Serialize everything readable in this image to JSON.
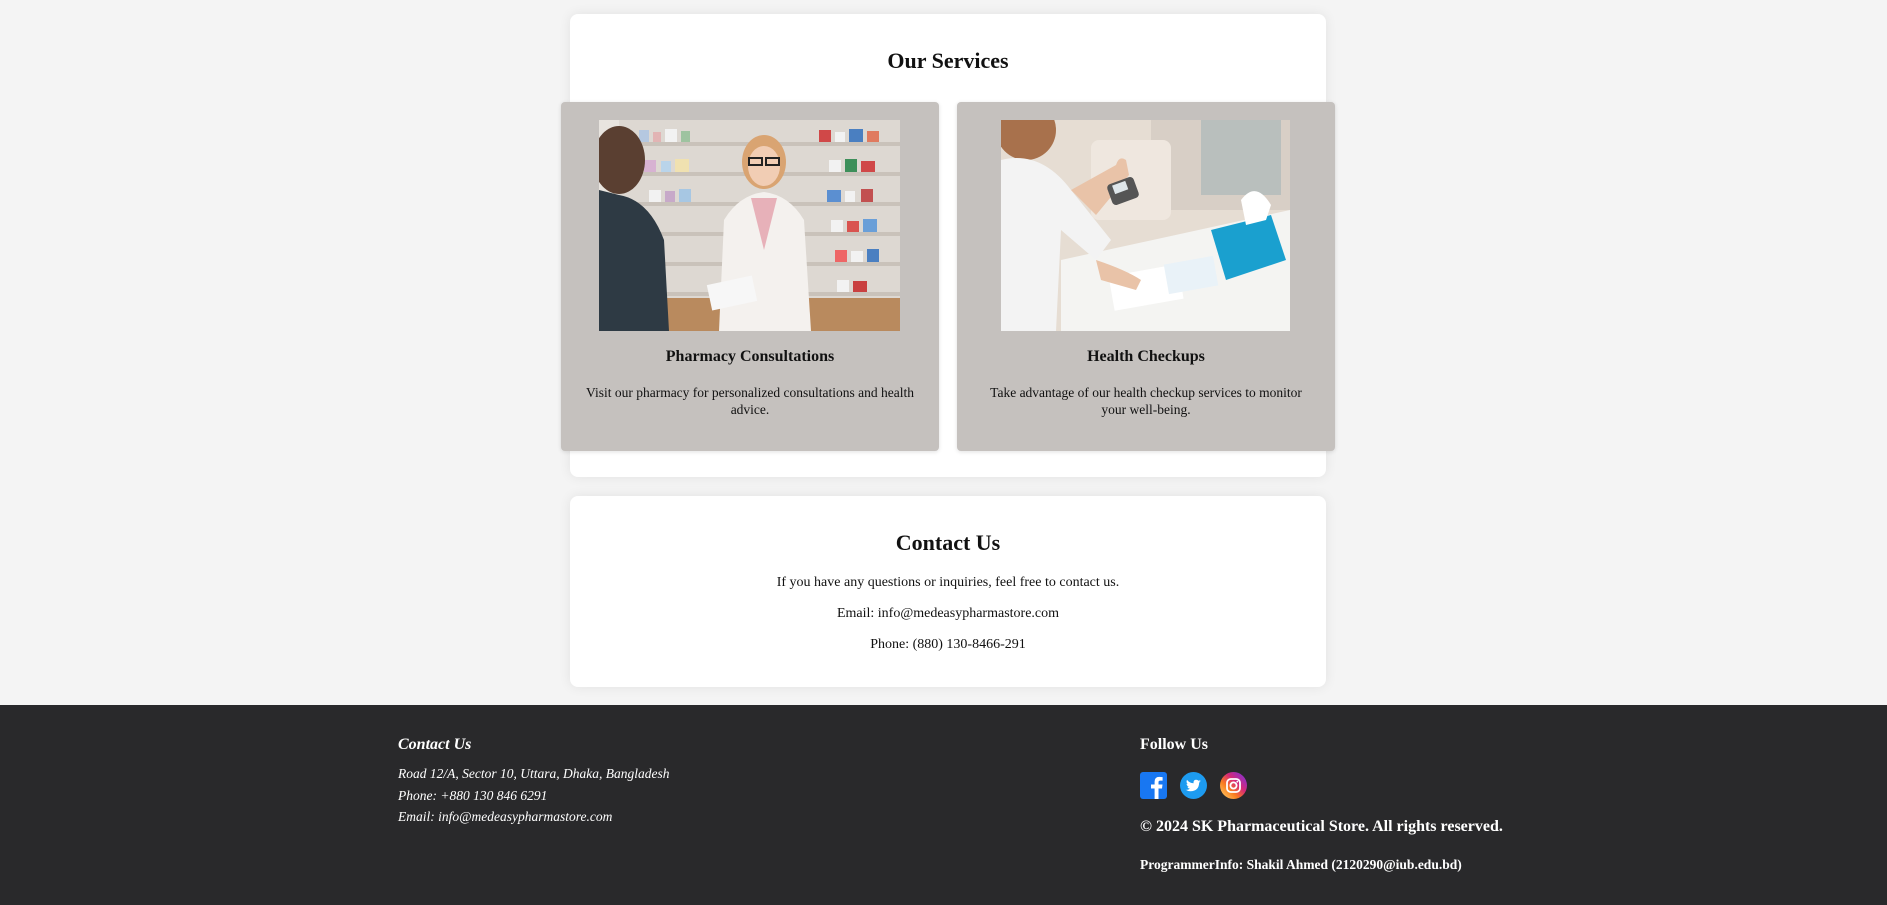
{
  "services": {
    "title": "Our Services",
    "items": [
      {
        "title": "Pharmacy Consultations",
        "description": "Visit our pharmacy for personalized consultations and health advice.",
        "image": "pharmacist-consultation-photo"
      },
      {
        "title": "Health Checkups",
        "description": "Take advantage of our health checkup services to monitor your well-being.",
        "image": "blood-pressure-checkup-photo"
      }
    ]
  },
  "contact": {
    "title": "Contact Us",
    "intro": "If you have any questions or inquiries, feel free to contact us.",
    "email": "Email: info@medeasypharmastore.com",
    "phone": "Phone: (880) 130-8466-291"
  },
  "footer": {
    "contact_title": "Contact Us",
    "address": "Road 12/A, Sector 10, Uttara, Dhaka, Bangladesh",
    "phone": "Phone: +880 130 846 6291",
    "email": "Email: info@medeasypharmastore.com",
    "follow_title": "Follow Us",
    "social": [
      "facebook-icon",
      "twitter-icon",
      "instagram-icon"
    ],
    "copyright": "© 2024 SK Pharmaceutical Store. All rights reserved.",
    "programmer": "ProgrammerInfo: Shakil Ahmed (2120290@iub.edu.bd)"
  },
  "colors": {
    "background": "#f4f4f4",
    "service_card": "#c5c1be",
    "footer": "#29292b",
    "facebook": "#1877f2",
    "twitter": "#1d9bf0"
  }
}
